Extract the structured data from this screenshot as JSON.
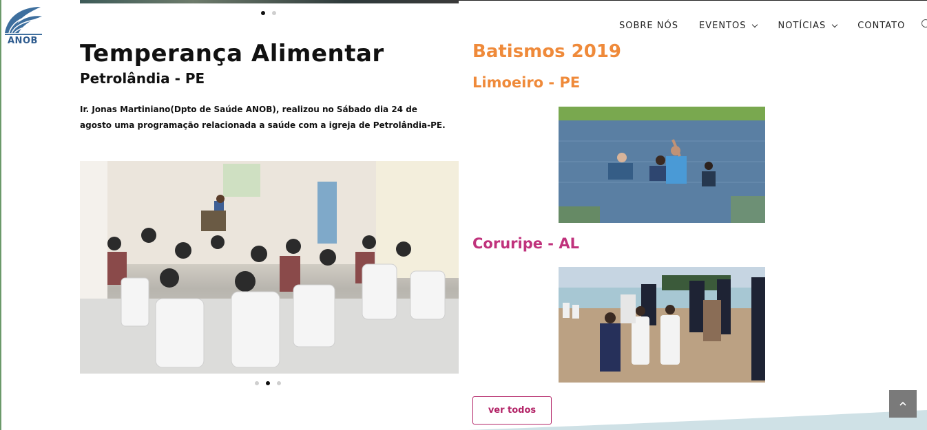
{
  "brand": {
    "logo_text": "ANOB"
  },
  "nav": {
    "items": [
      {
        "label": "SOBRE NÓS",
        "dropdown": false
      },
      {
        "label": "EVENTOS",
        "dropdown": true
      },
      {
        "label": "NOTÍCIAS",
        "dropdown": true
      },
      {
        "label": "CONTATO",
        "dropdown": false
      }
    ],
    "search_icon": "search-icon"
  },
  "article": {
    "title": "Temperança Alimentar",
    "subtitle": "Petrolândia - PE",
    "description": "Ir. Jonas Martiniano(Dpto de Saúde ANOB), realizou no Sábado dia 24 de agosto uma programação relacionada a saúde com a igreja de Petrolândia-PE."
  },
  "carousels": {
    "top": {
      "slides": 2,
      "active": 1
    },
    "church": {
      "slides": 3,
      "active": 2
    }
  },
  "baptisms": {
    "title": "Batismos 2019",
    "locations": [
      {
        "name": "Limoeiro - PE"
      },
      {
        "name": "Coruripe - AL"
      }
    ],
    "view_all_label": "ver todos"
  },
  "colors": {
    "orange": "#ef8a3a",
    "magenta": "#c0327c",
    "button_border": "#b22266",
    "logo_blue": "#2f5c8f"
  },
  "icons": {
    "back_to_top": "chevron-up-icon"
  }
}
